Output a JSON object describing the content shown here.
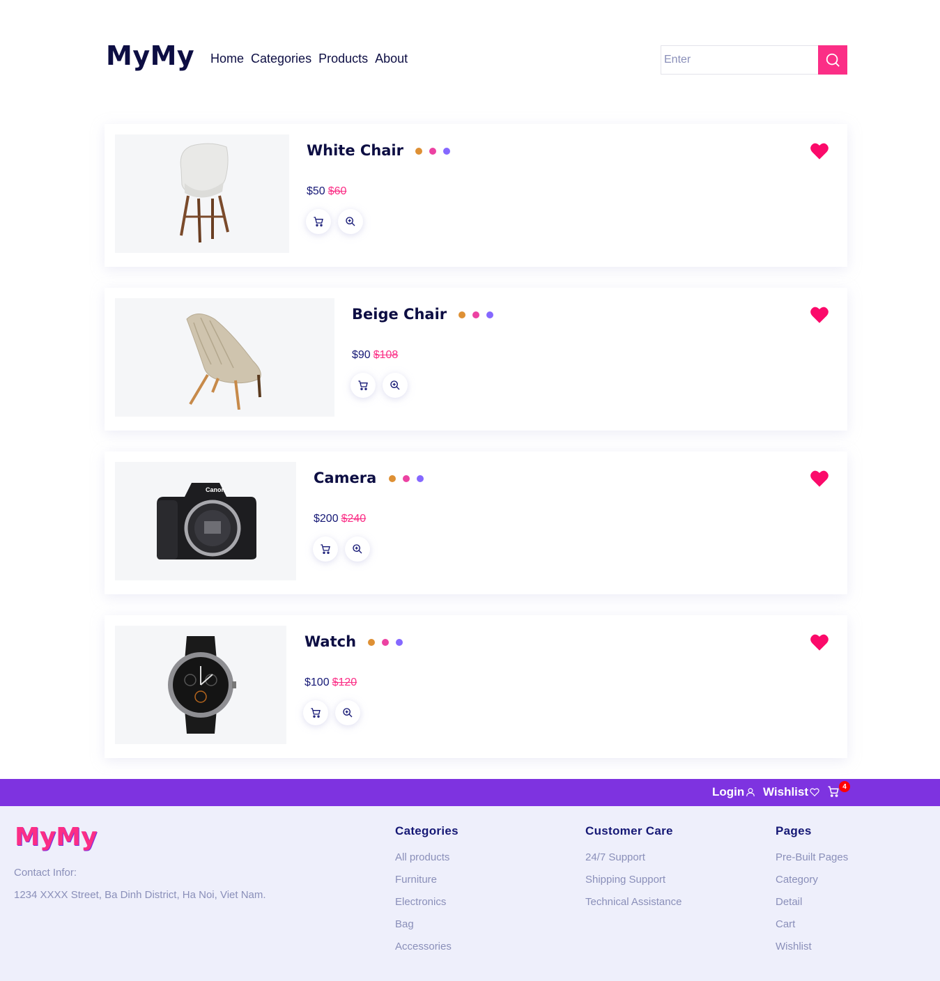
{
  "header": {
    "logo": "MyMy",
    "nav": [
      "Home",
      "Categories",
      "Products",
      "About"
    ],
    "search_placeholder": "Enter"
  },
  "products": [
    {
      "name": "White Chair",
      "price": "$50",
      "old_price": "$60"
    },
    {
      "name": "Beige Chair",
      "price": "$90",
      "old_price": "$108"
    },
    {
      "name": "Camera",
      "price": "$200",
      "old_price": "$240"
    },
    {
      "name": "Watch",
      "price": "$100",
      "old_price": "$120"
    }
  ],
  "colors": {
    "accent_pink": "#fb2e86",
    "purple": "#7e33e0",
    "navy": "#151875",
    "dot_orange": "#de9034",
    "dot_pink": "#ec42a2",
    "dot_purple": "#8568ff"
  },
  "topbar": {
    "login": "Login",
    "wishlist": "Wishlist",
    "cart_count": "4"
  },
  "footer": {
    "logo": "MyMy",
    "contact_label": "Contact Infor:",
    "address": "1234 XXXX Street, Ba Dinh District, Ha Noi, Viet Nam.",
    "categories": {
      "title": "Categories",
      "items": [
        "All products",
        "Furniture",
        "Electronics",
        "Bag",
        "Accessories"
      ]
    },
    "customer_care": {
      "title": "Customer Care",
      "items": [
        "24/7 Support",
        "Shipping Support",
        "Technical Assistance"
      ]
    },
    "pages": {
      "title": "Pages",
      "items": [
        "Pre-Built Pages",
        "Category",
        "Detail",
        "Cart",
        "Wishlist"
      ]
    }
  }
}
